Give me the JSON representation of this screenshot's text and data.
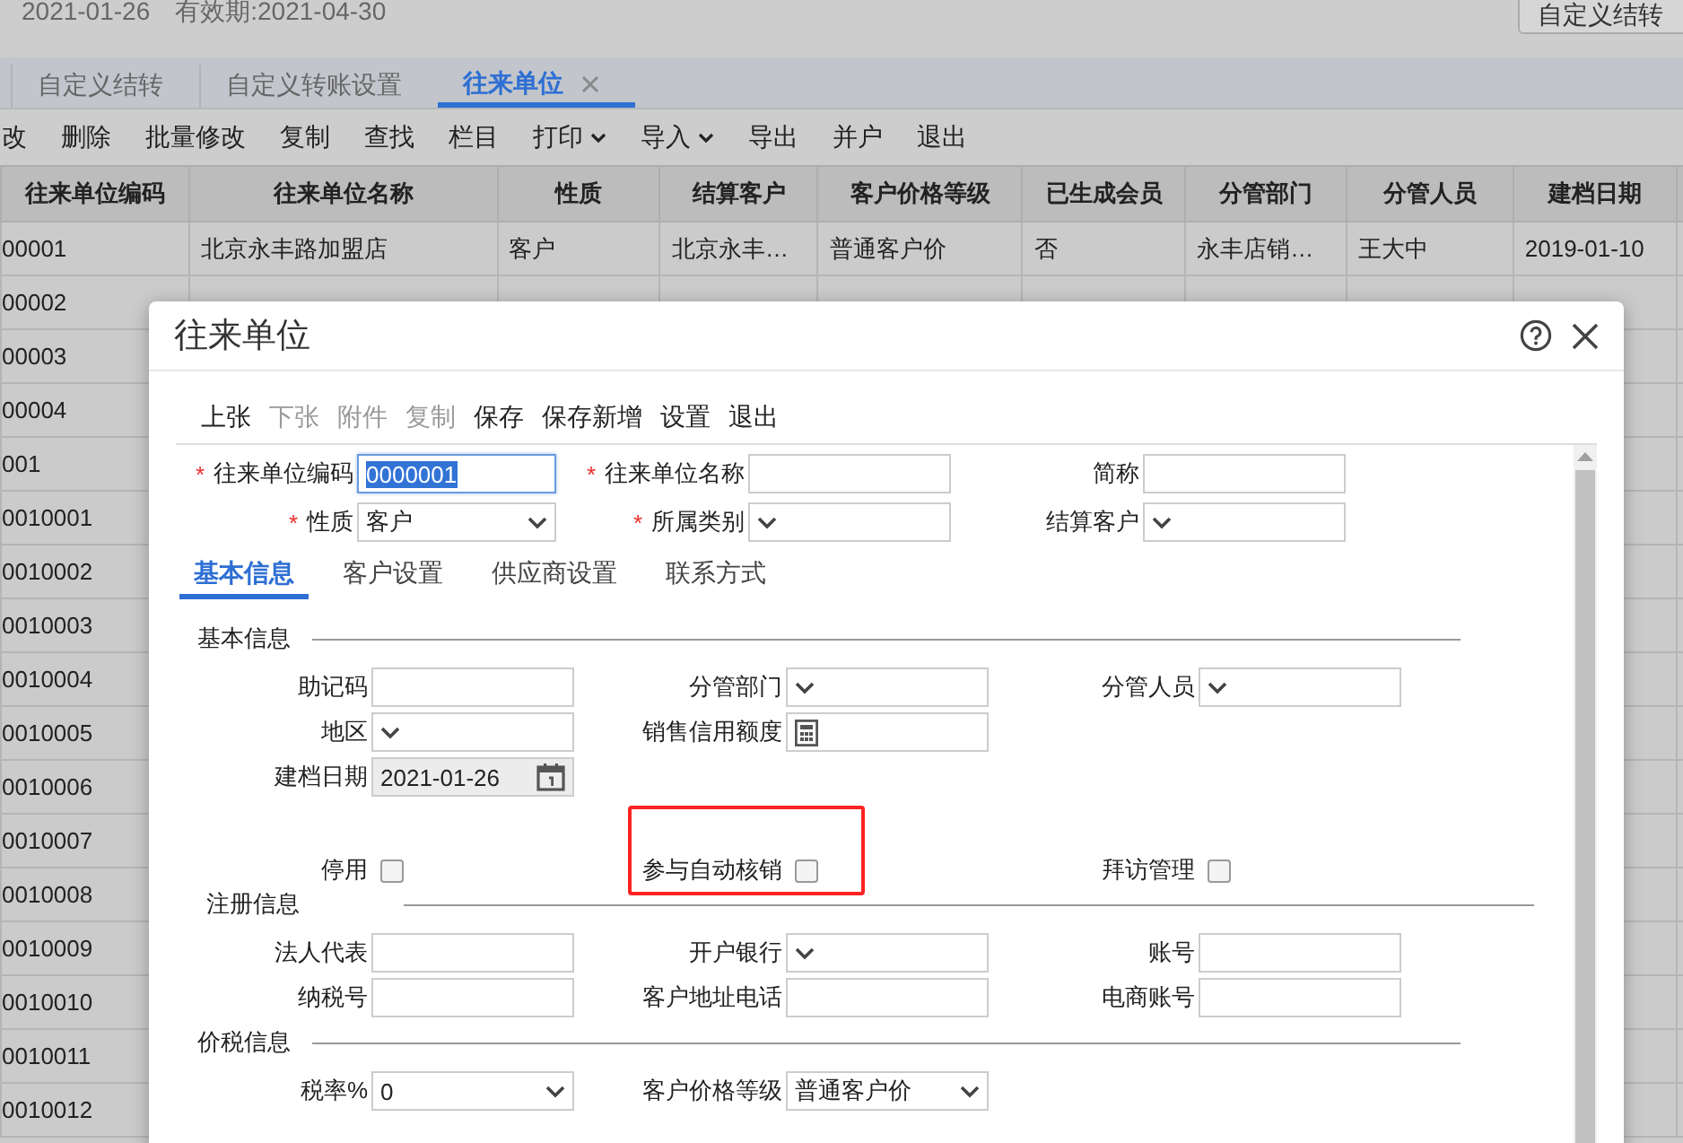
{
  "header": {
    "date": "2021-01-26",
    "validity": "有效期:2021-04-30",
    "action_button": "自定义结转"
  },
  "tabs": [
    {
      "label": "自定义结转",
      "selected": false,
      "closable": false
    },
    {
      "label": "自定义转账设置",
      "selected": false,
      "closable": false
    },
    {
      "label": "往来单位",
      "selected": true,
      "closable": true
    }
  ],
  "toolbar": [
    {
      "label": "改",
      "dropdown": false
    },
    {
      "label": "删除",
      "dropdown": false
    },
    {
      "label": "批量修改",
      "dropdown": false
    },
    {
      "label": "复制",
      "dropdown": false
    },
    {
      "label": "查找",
      "dropdown": false
    },
    {
      "label": "栏目",
      "dropdown": false
    },
    {
      "label": "打印",
      "dropdown": true
    },
    {
      "label": "导入",
      "dropdown": true
    },
    {
      "label": "导出",
      "dropdown": false
    },
    {
      "label": "并户",
      "dropdown": false
    },
    {
      "label": "退出",
      "dropdown": false
    }
  ],
  "table": {
    "columns": [
      "往来单位编码",
      "往来单位名称",
      "性质",
      "结算客户",
      "客户价格等级",
      "已生成会员",
      "分管部门",
      "分管人员",
      "建档日期"
    ],
    "rows": [
      {
        "code": "00001",
        "name": "北京永丰路加盟店",
        "nature": "客户",
        "settle": "北京永丰…",
        "price": "普通客户价",
        "member": "否",
        "dept": "永丰店销…",
        "staff": "王大中",
        "date": "2019-01-10"
      },
      {
        "code": "00002"
      },
      {
        "code": "00003"
      },
      {
        "code": "00004"
      },
      {
        "code": "001"
      },
      {
        "code": "0010001"
      },
      {
        "code": "0010002"
      },
      {
        "code": "0010003"
      },
      {
        "code": "0010004"
      },
      {
        "code": "0010005"
      },
      {
        "code": "0010006"
      },
      {
        "code": "0010007"
      },
      {
        "code": "0010008"
      },
      {
        "code": "0010009"
      },
      {
        "code": "0010010"
      },
      {
        "code": "0010011"
      },
      {
        "code": "0010012"
      }
    ]
  },
  "dialog": {
    "title": "往来单位",
    "toolbar": [
      {
        "label": "上张",
        "disabled": false
      },
      {
        "label": "下张",
        "disabled": true
      },
      {
        "label": "附件",
        "disabled": true
      },
      {
        "label": "复制",
        "disabled": true
      },
      {
        "label": "保存",
        "disabled": false
      },
      {
        "label": "保存新增",
        "disabled": false
      },
      {
        "label": "设置",
        "disabled": false
      },
      {
        "label": "退出",
        "disabled": false
      }
    ],
    "head_rows": [
      [
        {
          "label": "往来单位编码",
          "kind": "text",
          "required_mark": "*",
          "value": "0000001",
          "focused": true
        },
        {
          "label": "往来单位名称",
          "kind": "text",
          "required_mark": "*"
        },
        {
          "label": "简称",
          "kind": "text"
        }
      ],
      [
        {
          "label": "性质",
          "kind": "select",
          "required_mark": "*",
          "value": "客户"
        },
        {
          "label": "所属类别",
          "kind": "select",
          "required_mark": "*"
        },
        {
          "label": "结算客户",
          "kind": "select"
        }
      ]
    ],
    "tabs": [
      {
        "label": "基本信息",
        "selected": true
      },
      {
        "label": "客户设置",
        "selected": false
      },
      {
        "label": "供应商设置",
        "selected": false
      },
      {
        "label": "联系方式",
        "selected": false
      }
    ],
    "sections": [
      {
        "title": "基本信息",
        "rows": [
          [
            {
              "label": "助记码",
              "kind": "text"
            },
            {
              "label": "分管部门",
              "kind": "select"
            },
            {
              "label": "分管人员",
              "kind": "select"
            }
          ],
          [
            {
              "label": "地区",
              "kind": "select"
            },
            {
              "label": "销售信用额度",
              "kind": "number"
            },
            {
              "kind": "empty"
            }
          ],
          [
            {
              "label": "建档日期",
              "kind": "date",
              "value": "2021-01-26",
              "disabled": true
            },
            {
              "kind": "empty"
            },
            {
              "kind": "empty"
            }
          ]
        ],
        "options": [
          {
            "label": "停用",
            "kind": "checkbox",
            "checked": false
          },
          {
            "label": "参与自动核销",
            "kind": "checkbox",
            "checked": false,
            "highlighted": true
          },
          {
            "label": "拜访管理",
            "kind": "checkbox",
            "checked": false
          }
        ]
      },
      {
        "title": "注册信息",
        "rows": [
          [
            {
              "label": "法人代表",
              "kind": "text"
            },
            {
              "label": "开户银行",
              "kind": "select"
            },
            {
              "label": "账号",
              "kind": "text"
            }
          ],
          [
            {
              "label": "纳税号",
              "kind": "text"
            },
            {
              "label": "客户地址电话",
              "kind": "text"
            },
            {
              "label": "电商账号",
              "kind": "text"
            }
          ]
        ]
      },
      {
        "title": "价税信息",
        "rows": [
          [
            {
              "label": "税率%",
              "kind": "select",
              "value": "0"
            },
            {
              "label": "客户价格等级",
              "kind": "select",
              "value": "普通客户价"
            },
            {
              "kind": "empty"
            }
          ]
        ]
      }
    ]
  }
}
